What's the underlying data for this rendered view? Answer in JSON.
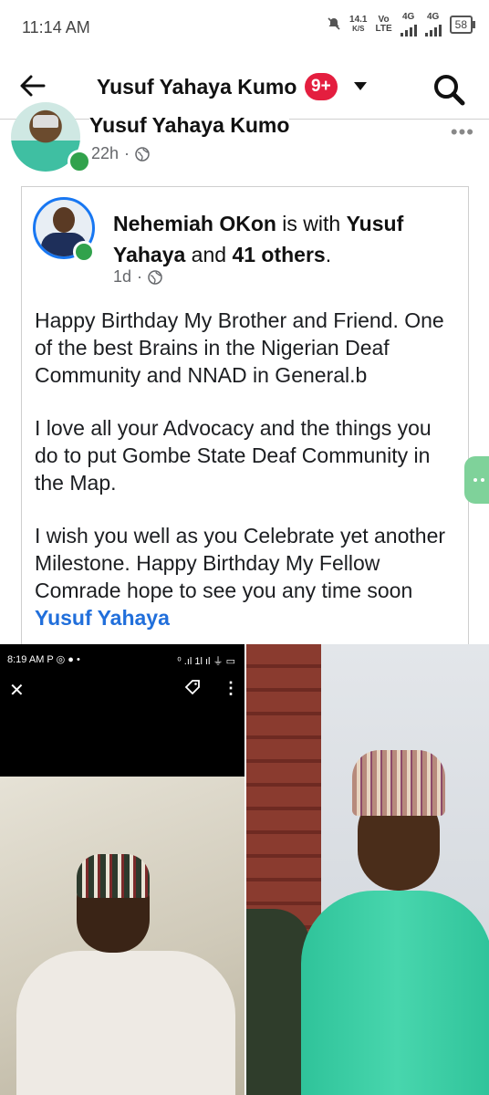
{
  "status_bar": {
    "time": "11:14 AM",
    "speed": "14.1",
    "speed_unit": "K/S",
    "vo": "Vo",
    "lte": "LTE",
    "net1": "4G",
    "net2": "4G",
    "battery": "58"
  },
  "header": {
    "title": "Yusuf Yahaya Kumo",
    "notification_badge": "9+"
  },
  "post": {
    "author": "Yusuf Yahaya Kumo",
    "time": "22h",
    "separator": "·",
    "more": "•••"
  },
  "shared_post": {
    "author": "Nehemiah OKon",
    "with_text": " is with ",
    "tagged": "Yusuf Yahaya",
    "and_text": " and ",
    "others": "41 others",
    "period": ".",
    "time": "1d",
    "separator": "·",
    "paragraph1": "Happy Birthday My Brother and Friend. One of the best Brains in the Nigerian Deaf Community and NNAD in General.b",
    "paragraph2": "I love all your Advocacy and the things you do to put Gombe State Deaf Community in the Map.",
    "paragraph3": "I wish you well as you Celebrate yet another Milestone. Happy Birthday My Fellow Comrade hope to see you any time soon ",
    "mention": "Yusuf Yahaya"
  },
  "image_left": {
    "time": "8:19 AM",
    "icons": "P ◎ ● •",
    "status_right": "⁰ .ıl 1l ıl ⏚ ▭",
    "close": "✕",
    "dots": "⋮"
  }
}
